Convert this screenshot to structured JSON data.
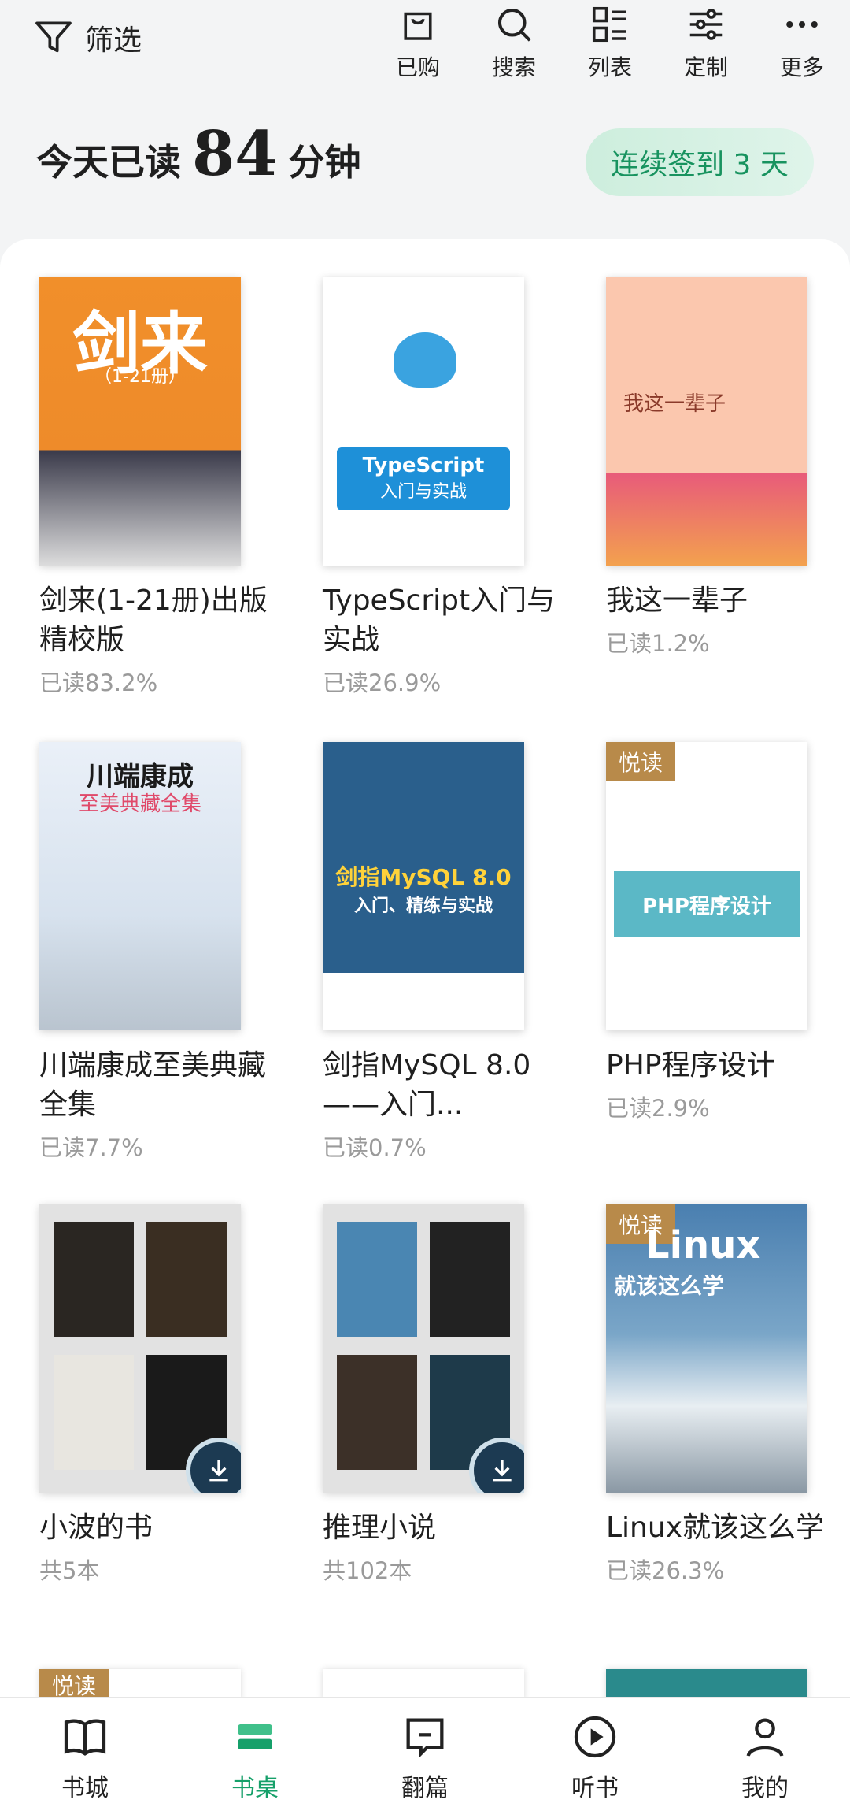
{
  "topbar": {
    "filter_label": "筛选",
    "actions": [
      {
        "label": "已购"
      },
      {
        "label": "搜索"
      },
      {
        "label": "列表"
      },
      {
        "label": "定制"
      },
      {
        "label": "更多"
      }
    ]
  },
  "reading": {
    "prefix": "今天已读",
    "minutes": "84",
    "suffix": "分钟",
    "streak": "连续签到 3 天"
  },
  "books": [
    {
      "title": "剑来(1-21册)出版精校版",
      "progress": "已读83.2%",
      "cover_text": "剑来",
      "cover_sub": "（1-21册）"
    },
    {
      "title": "TypeScript入门与实战",
      "progress": "已读26.9%",
      "cover_text": "TypeScript",
      "cover_sub": "入门与实战"
    },
    {
      "title": "我这一辈子",
      "progress": "已读1.2%",
      "cover_text": "我这一辈子"
    },
    {
      "title": "川端康成至美典藏全集",
      "progress": "已读7.7%",
      "cover_text": "川端康成",
      "cover_sub": "至美典藏全集"
    },
    {
      "title": "剑指MySQL 8.0——入门...",
      "progress": "已读0.7%",
      "cover_text": "剑指MySQL 8.0",
      "cover_sub": "入门、精练与实战"
    },
    {
      "title": "PHP程序设计",
      "progress": "已读2.9%",
      "badge": "悦读",
      "cover_text": "PHP程序设计"
    },
    {
      "title": "小波的书",
      "progress": "共5本"
    },
    {
      "title": "推理小说",
      "progress": "共102本"
    },
    {
      "title": "Linux就该这么学",
      "progress": "已读26.3%",
      "badge": "悦读",
      "cover_text": "Linux",
      "cover_sub": "就该这么学"
    }
  ],
  "bottom_badge": "悦读",
  "nav": [
    {
      "label": "书城"
    },
    {
      "label": "书桌"
    },
    {
      "label": "翻篇"
    },
    {
      "label": "听书"
    },
    {
      "label": "我的"
    }
  ],
  "colors": {
    "accent": "#16a06a",
    "badge": "#b88a4a"
  }
}
